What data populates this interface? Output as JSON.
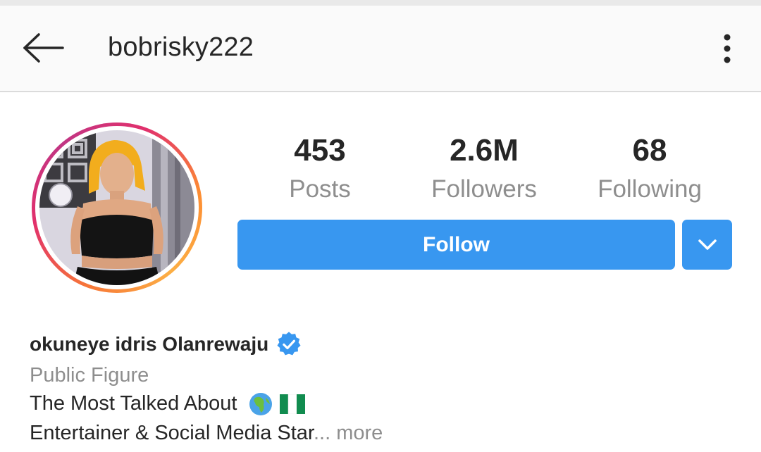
{
  "header": {
    "username": "bobrisky222",
    "back_icon": "arrow-left-icon",
    "menu_icon": "more-vertical-icon"
  },
  "stats": [
    {
      "value": "453",
      "label": "Posts"
    },
    {
      "value": "2.6M",
      "label": "Followers"
    },
    {
      "value": "68",
      "label": "Following"
    }
  ],
  "actions": {
    "follow_label": "Follow",
    "dropdown_icon": "chevron-down-icon"
  },
  "bio": {
    "name": "okuneye idris Olanrewaju",
    "verified_icon": "verified-badge-icon",
    "category": "Public Figure",
    "line1": "The Most Talked About",
    "line1_emojis": [
      "globe-africa-icon",
      "nigeria-flag-icon"
    ],
    "line2": "Entertainer & Social Media Star",
    "ellipsis": "...",
    "more_label": " more"
  },
  "colors": {
    "accent_blue": "#3897f0",
    "text_dark": "#262626",
    "text_muted": "#8e8e8e",
    "appbar_bg": "#fafafa"
  }
}
